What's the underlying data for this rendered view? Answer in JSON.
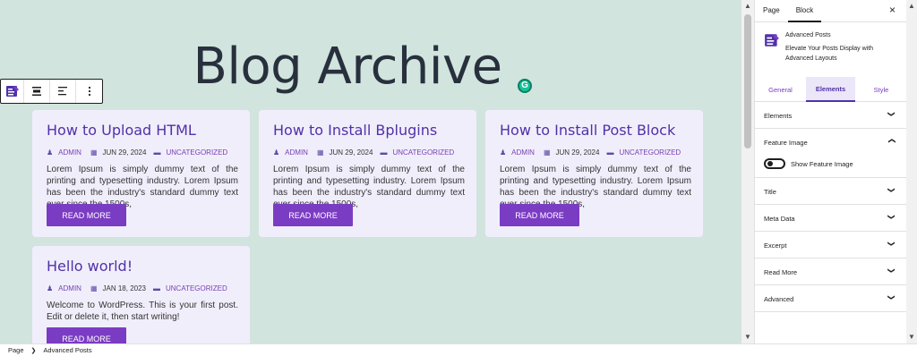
{
  "canvas": {
    "title": "Blog Archive",
    "grammarly_icon_letter": "G",
    "posts": [
      {
        "title": "How to Upload HTML",
        "author": "ADMIN",
        "date": "JUN 29, 2024",
        "category": "UNCATEGORIZED",
        "excerpt": "Lorem Ipsum is simply dummy text of the printing and typesetting industry. Lorem Ipsum has been the industry's standard dummy text ever since the 1500s,",
        "button": "READ MORE"
      },
      {
        "title": "How to Install Bplugins",
        "author": "ADMIN",
        "date": "JUN 29, 2024",
        "category": "UNCATEGORIZED",
        "excerpt": "Lorem Ipsum is simply dummy text of the printing and typesetting industry. Lorem Ipsum has been the industry's standard dummy text ever since the 1500s,",
        "button": "READ MORE"
      },
      {
        "title": "How to Install Post Block",
        "author": "ADMIN",
        "date": "JUN 29, 2024",
        "category": "UNCATEGORIZED",
        "excerpt": "Lorem Ipsum is simply dummy text of the printing and typesetting industry. Lorem Ipsum has been the industry's standard dummy text ever since the 1500s,",
        "button": "READ MORE"
      },
      {
        "title": "Hello world!",
        "author": "ADMIN",
        "date": "JAN 18, 2023",
        "category": "UNCATEGORIZED",
        "excerpt": "Welcome to WordPress. This is your first post. Edit or delete it, then start writing!",
        "button": "READ MORE"
      }
    ],
    "toolbar_icons": [
      "block-icon",
      "align-center-icon",
      "align-left-icon",
      "more-options-icon"
    ]
  },
  "sidebar": {
    "tabs": [
      "Page",
      "Block"
    ],
    "active_tab": "Block",
    "close_label": "×",
    "block_name": "Advanced Posts",
    "block_description": "Elevate Your Posts Display with Advanced Layouts",
    "inner_tabs": [
      "General",
      "Elements",
      "Style"
    ],
    "active_inner_tab": "Elements",
    "panels": {
      "elements": "Elements",
      "feature_image": "Feature Image",
      "show_feature_image": "Show Feature Image",
      "title": "Title",
      "meta_data": "Meta Data",
      "excerpt": "Excerpt",
      "read_more": "Read More",
      "advanced": "Advanced"
    },
    "toggle_show_feature_image": false
  },
  "footer": {
    "breadcrumb": [
      "Page",
      "Advanced Posts"
    ]
  },
  "colors": {
    "canvas_bg": "#d1e4dd",
    "card_bg": "#f1eefb",
    "accent": "#7b3cc4",
    "title_purple": "#5031a9"
  }
}
